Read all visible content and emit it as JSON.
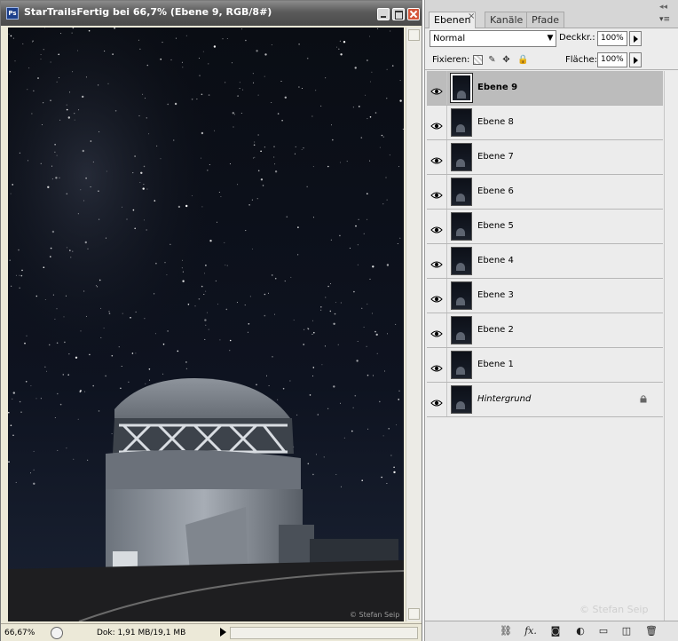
{
  "document": {
    "title": "StarTrailsFertig bei 66,7% (Ebene 9, RGB/8#)",
    "app_icon": "Ps",
    "canvas_watermark": "© Stefan Seip",
    "status": {
      "zoom": "66,67%",
      "doc_info": "Dok: 1,91 MB/19,1 MB"
    }
  },
  "panel": {
    "tabs": [
      {
        "label": "Ebenen",
        "active": true
      },
      {
        "label": "Kanäle",
        "active": false
      },
      {
        "label": "Pfade",
        "active": false
      }
    ],
    "tab_close": "×",
    "blend_mode": "Normal",
    "opacity_label": "Deckkr.:",
    "opacity_value": "100%",
    "lock_label": "Fixieren:",
    "fill_label": "Fläche:",
    "fill_value": "100%",
    "layers": [
      {
        "name": "Ebene 9",
        "active": true,
        "visible": true,
        "locked": false
      },
      {
        "name": "Ebene 8",
        "active": false,
        "visible": true,
        "locked": false
      },
      {
        "name": "Ebene 7",
        "active": false,
        "visible": true,
        "locked": false
      },
      {
        "name": "Ebene 6",
        "active": false,
        "visible": true,
        "locked": false
      },
      {
        "name": "Ebene 5",
        "active": false,
        "visible": true,
        "locked": false
      },
      {
        "name": "Ebene 4",
        "active": false,
        "visible": true,
        "locked": false
      },
      {
        "name": "Ebene 3",
        "active": false,
        "visible": true,
        "locked": false
      },
      {
        "name": "Ebene 2",
        "active": false,
        "visible": true,
        "locked": false
      },
      {
        "name": "Ebene 1",
        "active": false,
        "visible": true,
        "locked": false
      },
      {
        "name": "Hintergrund",
        "active": false,
        "visible": true,
        "locked": true,
        "italic": true
      }
    ],
    "watermark": "© Stefan Seip",
    "bottom_icons": [
      "link-icon",
      "fx-icon",
      "mask-icon",
      "adjustment-icon",
      "folder-icon",
      "new-layer-icon",
      "trash-icon"
    ],
    "fx_label": "fx."
  },
  "colors": {
    "active_layer": "#bcbcbc",
    "panel_bg": "#ececec",
    "sky": "#0b0e15"
  }
}
